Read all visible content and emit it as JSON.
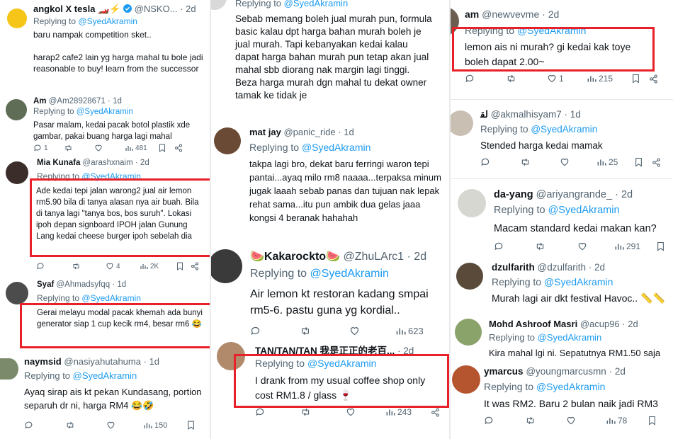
{
  "colors": {
    "accent": "#1d9bf0",
    "highlight": "#e8202a",
    "muted": "#536471"
  },
  "reply_prefix": "Replying to",
  "tweets": [
    {
      "name": "angkol X tesla",
      "name_suffix": "🏎️⚡",
      "handle": "@NSKO...",
      "time": "2d",
      "mention": "@SyedAkramin",
      "text": "baru nampak competition sket..\n\nharap2 cafe2 lain yg harga mahal tu bole jadi reasonable to buy! learn from the successor"
    },
    {
      "name": "Am",
      "handle": "@Am28928671",
      "time": "1d",
      "mention": "@SyedAkramin",
      "text": "Pasar malam, kedai pacak botol plastik xde gambar, pakai buang harga lagi mahal",
      "stats": {
        "replies": "1",
        "retweets": "",
        "likes": "",
        "views": "481"
      }
    },
    {
      "name": "Mia Kunafa",
      "handle": "@arashxnaim",
      "time": "2d",
      "mention": "@SyedAkramin",
      "text": "Ade kedai tepi jalan warong2 jual air lemon rm5.90 bila di tanya alasan nya air buah. Bila di tanya lagi \"tanya bos, bos suruh\". Lokasi ipoh depan signboard IPOH jalan Gunung Lang kedai cheese burger ipoh sebelah dia",
      "stats": {
        "replies": "",
        "retweets": "",
        "likes": "4",
        "views": "2K"
      }
    },
    {
      "name": "Syaf",
      "handle": "@Ahmadsyfqq",
      "time": "1d",
      "mention": "@SyedAkramin",
      "text": "Gerai melayu modal pacak khemah ada bunyi generator siap 1 cup kecik rm4, besar rm6 😂"
    },
    {
      "name": "naymsid",
      "handle": "@nasiyahutahuma",
      "time": "1d",
      "mention": "@SyedAkramin",
      "text": "Ayaq sirap ais kt pekan Kundasang, portion separuh dr ni, harga RM4 😂🤣",
      "stats": {
        "replies": "",
        "retweets": "",
        "likes": "",
        "views": "150"
      }
    },
    {
      "name": "",
      "handle": "",
      "time": "",
      "mention": "@SyedAkramin",
      "text": "Sebab memang boleh jual murah pun, formula basic kalau dpt harga bahan murah boleh je jual murah. Tapi kebanyakan kedai kalau dapat harga bahan murah pun tetap akan jual mahal sbb diorang nak margin lagi tinggi.\nBeza harga murah dgn mahal tu dekat owner tamak ke tidak je"
    },
    {
      "name": "mat jay",
      "handle": "@panic_ride",
      "time": "1d",
      "mention": "@SyedAkramin",
      "text": "takpa lagi bro, dekat baru ferringi waron tepi pantai...ayaq milo rm8 naaaa...terpaksa minum jugak laaah sebab panas dan tujuan nak lepak rehat sama...itu pun ambik dua gelas jaaa kongsi 4 beranak hahahah"
    },
    {
      "name": "Kakarockto",
      "name_prefix": "🍉",
      "name_suffix": "🍉",
      "handle": "@ZhuLArc1",
      "time": "2d",
      "mention": "@SyedAkramin",
      "text": "Air lemon kt restoran kadang smpai rm5-6. pastu guna yg kordial..",
      "stats": {
        "replies": "",
        "retweets": "",
        "likes": "",
        "views": "623"
      }
    },
    {
      "name": "TAN/TAN/TAN 我是正正的老百...",
      "handle": "",
      "time": "2d",
      "mention": "@SyedAkramin",
      "text": "I drank from my usual coffee shop only cost RM1.8 / glass 🍷",
      "stats": {
        "replies": "",
        "retweets": "",
        "likes": "",
        "views": "243"
      }
    },
    {
      "name": "am",
      "handle": "@newvevme",
      "time": "2d",
      "mention": "@SyedAkramin",
      "text": "lemon ais ni murah? gi kedai kak toye boleh dapat 2.00~",
      "stats": {
        "replies": "",
        "retweets": "",
        "likes": "1",
        "views": "215"
      }
    },
    {
      "name": "ﻟﻘ",
      "handle": "@akmalhisyam7",
      "time": "1d",
      "mention": "@SyedAkramin",
      "text": "Stended harga kedai mamak",
      "stats": {
        "replies": "",
        "retweets": "",
        "likes": "",
        "views": "25"
      }
    },
    {
      "name": "da-yang",
      "handle": "@ariyangrande_",
      "time": "2d",
      "mention": "@SyedAkramin",
      "text": "Macam standard kedai makan kan?",
      "stats": {
        "replies": "",
        "retweets": "",
        "likes": "",
        "views": "291"
      }
    },
    {
      "name": "dzulfarith",
      "handle": "@dzulfarith",
      "time": "2d",
      "mention": "@SyedAkramin",
      "text": "Murah lagi air dkt festival Havoc.. 📏📏"
    },
    {
      "name": "Mohd Ashroof Masri",
      "handle": "@acup96",
      "time": "2d",
      "mention": "@SyedAkramin",
      "text": "Kira mahal lgi ni. Sepatutnya RM1.50 saja"
    },
    {
      "name": "ymarcus",
      "handle": "@youngmarcusmn",
      "time": "2d",
      "mention": "@SyedAkramin",
      "text": "It was RM2. Baru 2 bulan naik jadi RM3",
      "stats": {
        "replies": "",
        "retweets": "",
        "likes": "",
        "views": "78"
      }
    }
  ]
}
